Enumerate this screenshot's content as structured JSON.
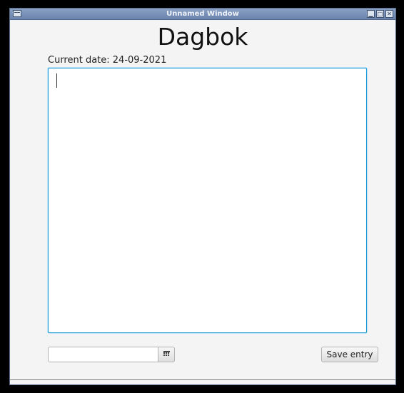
{
  "window": {
    "title": "Unnamed Window",
    "controls": [
      "minimize",
      "maximize",
      "close"
    ]
  },
  "app": {
    "heading": "Dagbok",
    "date_label": "Current date: 24-09-2021"
  },
  "editor": {
    "value": "",
    "focused": true
  },
  "footer": {
    "date_input_value": "",
    "calendar_icon": "calendar-icon",
    "save_label": "Save entry"
  },
  "colors": {
    "focus_border": "#1c9ad6",
    "titlebar": "#7890b8"
  }
}
